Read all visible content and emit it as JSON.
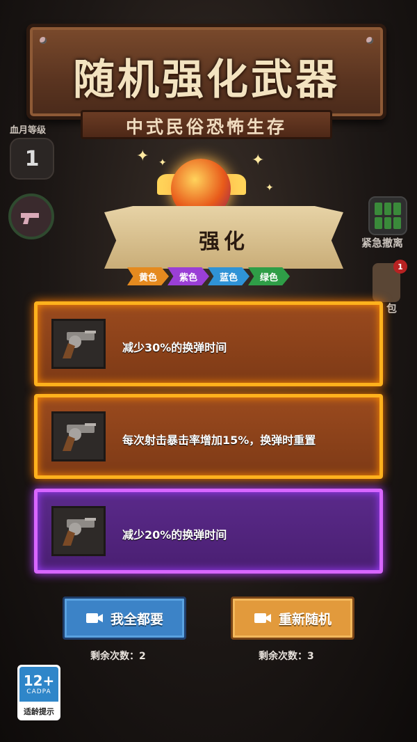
{
  "header": {
    "title": "随机强化武器",
    "subtitle": "中式民俗恐怖生存"
  },
  "left_panel": {
    "level_label": "血月等级",
    "level_value": "1"
  },
  "right_panel": {
    "evac_label": "紧急撤离",
    "bag_label": "包",
    "bag_badge": "1"
  },
  "banner": {
    "label": "强化"
  },
  "rarity_tags": [
    {
      "label": "黄色",
      "color": "#e58a1f"
    },
    {
      "label": "紫色",
      "color": "#9a3fd6"
    },
    {
      "label": "蓝色",
      "color": "#2f93d6"
    },
    {
      "label": "绿色",
      "color": "#2f9e47"
    }
  ],
  "cards": [
    {
      "text": "减少30%的换弹时间",
      "rarity": "yellow",
      "icon": "revolver-icon"
    },
    {
      "text": "每次射击暴击率增加15%，换弹时重置",
      "rarity": "yellow",
      "icon": "revolver-icon"
    },
    {
      "text": "减少20%的换弹时间",
      "rarity": "purple",
      "icon": "revolver-icon"
    }
  ],
  "buttons": {
    "take_all": {
      "label": "我全都要",
      "remaining": "剩余次数：2",
      "icon": "video-icon"
    },
    "reroll": {
      "label": "重新随机",
      "remaining": "剩余次数：3",
      "icon": "video-icon"
    }
  },
  "age_rating": {
    "value": "12+",
    "org": "CADPA",
    "tip": "适龄提示"
  }
}
